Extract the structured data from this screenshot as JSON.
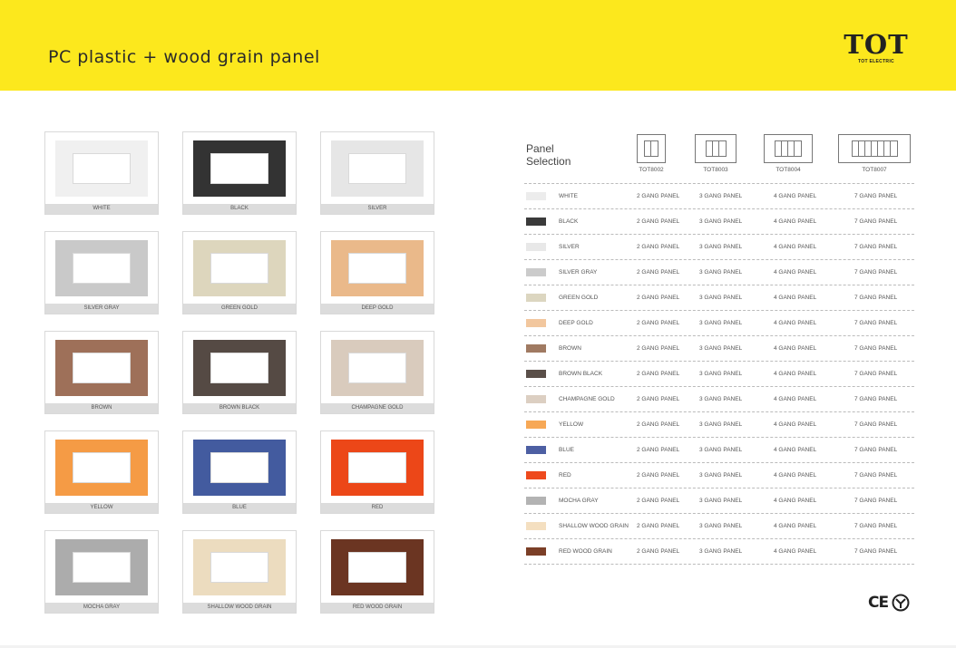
{
  "header": {
    "title": "PC plastic + wood grain panel",
    "brand": "TOT",
    "brand_sub": "TOT ELECTRIC",
    "color": "#fce81d"
  },
  "swatches": [
    {
      "label": "WHITE",
      "color": "#f0f0f0"
    },
    {
      "label": "BLACK",
      "color": "#333333"
    },
    {
      "label": "SILVER",
      "color": "#e6e6e6"
    },
    {
      "label": "SILVER GRAY",
      "color": "#c9c9c9"
    },
    {
      "label": "GREEN GOLD",
      "color": "#ddd6bd"
    },
    {
      "label": "DEEP GOLD",
      "color": "#eab98a"
    },
    {
      "label": "BROWN",
      "color": "#9e7059"
    },
    {
      "label": "BROWN BLACK",
      "color": "#554a44"
    },
    {
      "label": "CHAMPAGNE GOLD",
      "color": "#d9cbbd"
    },
    {
      "label": "YELLOW",
      "color": "#f59b45"
    },
    {
      "label": "BLUE",
      "color": "#435b9f"
    },
    {
      "label": "RED",
      "color": "#ec4718"
    },
    {
      "label": "MOCHA GRAY",
      "color": "#acacac"
    },
    {
      "label": "SHALLOW WOOD GRAIN",
      "color": "#ecdcbf"
    },
    {
      "label": "RED WOOD GRAIN",
      "color": "#6b3522"
    }
  ],
  "selection": {
    "title_line1": "Panel",
    "title_line2": "Selection",
    "models": [
      {
        "code": "TOT8002",
        "slots": 2
      },
      {
        "code": "TOT8003",
        "slots": 3
      },
      {
        "code": "TOT8004",
        "slots": 4
      },
      {
        "code": "TOT8007",
        "slots": 7
      }
    ],
    "rows": [
      {
        "name": "WHITE",
        "color": "#ececec"
      },
      {
        "name": "BLACK",
        "color": "#3a3a3a"
      },
      {
        "name": "SILVER",
        "color": "#e8e8e8"
      },
      {
        "name": "SILVER GRAY",
        "color": "#cbcbcb"
      },
      {
        "name": "GREEN GOLD",
        "color": "#dcd6c0"
      },
      {
        "name": "DEEP GOLD",
        "color": "#f2c79e"
      },
      {
        "name": "BROWN",
        "color": "#a07a62"
      },
      {
        "name": "BROWN BLACK",
        "color": "#5a4f49"
      },
      {
        "name": "CHAMPAGNE GOLD",
        "color": "#dccfc2"
      },
      {
        "name": "YELLOW",
        "color": "#f7a856"
      },
      {
        "name": "BLUE",
        "color": "#4d5fa3"
      },
      {
        "name": "RED",
        "color": "#ee4a1d"
      },
      {
        "name": "MOCHA GRAY",
        "color": "#b3b3b3"
      },
      {
        "name": "SHALLOW WOOD GRAIN",
        "color": "#f4dfc0"
      },
      {
        "name": "RED WOOD GRAIN",
        "color": "#7b3f27"
      }
    ],
    "gang_labels": [
      "2 GANG PANEL",
      "3 GANG PANEL",
      "4 GANG PANEL",
      "7 GANG PANEL"
    ]
  },
  "certs": {
    "ce": "CE"
  }
}
